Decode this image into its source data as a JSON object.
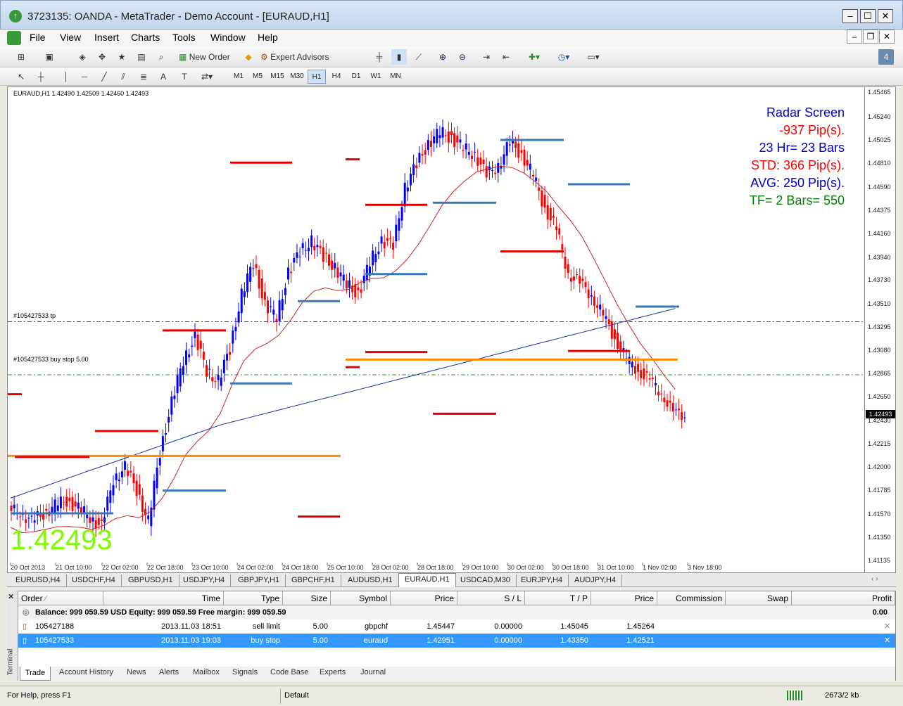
{
  "window": {
    "title": "3723135: OANDA - MetaTrader - Demo Account - [EURAUD,H1]",
    "icon": "metatrader-icon",
    "minimize": "–",
    "maximize": "☐",
    "close": "✕"
  },
  "menu": [
    "File",
    "View",
    "Insert",
    "Charts",
    "Tools",
    "Window",
    "Help"
  ],
  "toolbar": {
    "new_order": "New Order",
    "expert_advisors": "Expert Advisors"
  },
  "timeframes": [
    "M1",
    "M5",
    "M15",
    "M30",
    "H1",
    "H4",
    "D1",
    "W1",
    "MN"
  ],
  "active_timeframe": "H1",
  "chart": {
    "header": "EURAUD,H1  1.42490 1.42509 1.42460 1.42493",
    "big_price": "1.42493",
    "current_price_label": "1.42493",
    "order_label_tp": "#105427533 tp",
    "order_label_buystop": "#105427533 buy stop 5.00",
    "radar": {
      "title": "Radar Screen",
      "pips": "-937 Pip(s).",
      "hours": "23 Hr= 23 Bars",
      "std": "STD: 366 Pip(s).",
      "avg": "AVG: 250 Pip(s).",
      "tf": "TF= 2 Bars= 550"
    },
    "colors": {
      "bull": "#0000ff",
      "bear": "#ff0000",
      "big_price": "#7cfc00",
      "radar_title": "#0000cd",
      "radar_red": "#ff0000",
      "radar_green": "#008000",
      "ma_red": "#d22020",
      "ma_blue": "#1a2fa0",
      "level_orange": "#ff8c00",
      "level_blue": "#3a78b5"
    }
  },
  "chart_data": {
    "type": "candlestick",
    "ylim": [
      1.41125,
      1.45465
    ],
    "y_ticks": [
      "1.45465",
      "1.45240",
      "1.45025",
      "1.44810",
      "1.44590",
      "1.44375",
      "1.44160",
      "1.43940",
      "1.43730",
      "1.43510",
      "1.43295",
      "1.43080",
      "1.42865",
      "1.42650",
      "1.42430",
      "1.42215",
      "1.42000",
      "1.41785",
      "1.41570",
      "1.41350",
      "1.41135"
    ],
    "x_ticks": [
      "20 Oct 2013",
      "21 Oct 10:00",
      "22 Oct 02:00",
      "22 Oct 18:00",
      "23 Oct 10:00",
      "24 Oct 02:00",
      "24 Oct 18:00",
      "25 Oct 10:00",
      "28 Oct 02:00",
      "28 Oct 18:00",
      "29 Oct 10:00",
      "30 Oct 02:00",
      "30 Oct 18:00",
      "31 Oct 10:00",
      "1 Nov 02:00",
      "3 Nov 18:00"
    ],
    "close_path": [
      1.416,
      1.415,
      1.4158,
      1.4165,
      1.417,
      1.4162,
      1.4155,
      1.4145,
      1.419,
      1.42,
      1.418,
      1.415,
      1.4215,
      1.426,
      1.43,
      1.432,
      1.429,
      1.428,
      1.431,
      1.436,
      1.439,
      1.435,
      1.434,
      1.438,
      1.44,
      1.441,
      1.4395,
      1.4385,
      1.437,
      1.436,
      1.439,
      1.441,
      1.4405,
      1.446,
      1.448,
      1.45,
      1.451,
      1.4505,
      1.4495,
      1.449,
      1.447,
      1.448,
      1.45,
      1.449,
      1.447,
      1.444,
      1.442,
      1.438,
      1.437,
      1.436,
      1.434,
      1.432,
      1.43,
      1.429,
      1.428,
      1.427,
      1.425,
      1.4249
    ],
    "order_levels": {
      "buy_stop": 1.42951,
      "take_profit": 1.4335,
      "current": 1.42493
    }
  },
  "symbol_tabs": [
    "EURUSD,H4",
    "USDCHF,H4",
    "GBPUSD,H1",
    "USDJPY,H4",
    "GBPJPY,H1",
    "GBPCHF,H1",
    "AUDUSD,H1",
    "EURAUD,H1",
    "USDCAD,M30",
    "EURJPY,H4",
    "AUDJPY,H4"
  ],
  "active_symbol_tab": "EURAUD,H1",
  "terminal": {
    "side_label": "Terminal",
    "columns": [
      "Order",
      "Time",
      "Type",
      "Size",
      "Symbol",
      "Price",
      "S / L",
      "T / P",
      "Price",
      "Commission",
      "Swap",
      "Profit"
    ],
    "balance": "Balance: 999 059.59 USD  Equity: 999 059.59  Free margin: 999 059.59",
    "balance_profit": "0.00",
    "rows": [
      {
        "order": "105427188",
        "time": "2013.11.03 18:51",
        "type": "sell limit",
        "size": "5.00",
        "symbol": "gbpchf",
        "price": "1.45447",
        "sl": "0.00000",
        "tp": "1.45045",
        "cur": "1.45264"
      },
      {
        "order": "105427533",
        "time": "2013.11.03 19:03",
        "type": "buy stop",
        "size": "5.00",
        "symbol": "euraud",
        "price": "1.42951",
        "sl": "0.00000",
        "tp": "1.43350",
        "cur": "1.42521"
      }
    ],
    "tabs": [
      "Trade",
      "Account History",
      "News",
      "Alerts",
      "Mailbox",
      "Signals",
      "Code Base",
      "Experts",
      "Journal"
    ],
    "active_tab": "Trade"
  },
  "status": {
    "help": "For Help, press F1",
    "profile": "Default",
    "traffic": "2673/2 kb"
  }
}
